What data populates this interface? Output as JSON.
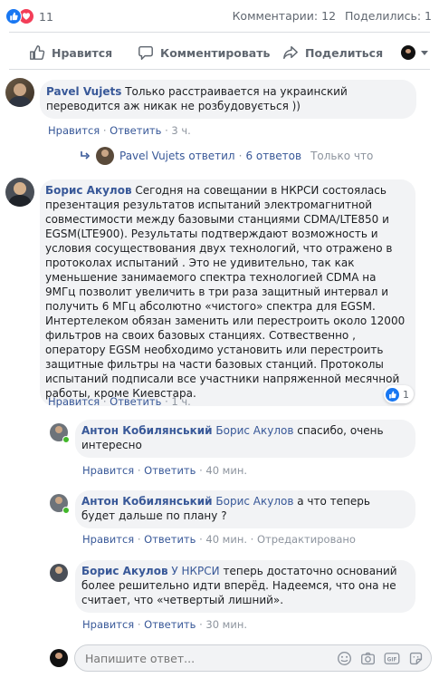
{
  "stats": {
    "reaction_count": "11",
    "comments": "Комментарии: 12",
    "shares": "Поделились: 1"
  },
  "actions": {
    "like": "Нравится",
    "comment": "Комментировать",
    "share": "Поделиться"
  },
  "meta": {
    "like": "Нравится",
    "reply": "Ответить",
    "sep": "·",
    "edited": "Отредактировано"
  },
  "c1": {
    "author": "Pavel Vujets",
    "text": "Только расстраивается на украинский переводится аж никак не розбудовується ))",
    "time": "3 ч."
  },
  "replies_summary": {
    "author": "Pavel Vujets",
    "verb": "ответил",
    "count": "6 ответов",
    "time": "Только что"
  },
  "c2": {
    "author": "Борис Акулов",
    "text": "Сегодня на совещании в НКРСИ состоялась презентация результатов испытаний электромагнитной совместимости между базовыми станциями CDMA/LTE850 и EGSM(LTE900). Результаты подтверждают возможность и условия сосуществования двух технологий, что отражено в протоколах испытаний . Это не удивительно, так как уменьшение занимаемого спектра технологией CDMA на 9МГц позволит увеличить в три раза защитный интервал и получить 6 МГц абсолютно «чистого» спектра для EGSM. Интертелеком обязан заменить или перестроить около 12000 фильтров на своих базовых станциях. Сотвественно , оператору EGSM необходимо установить или перестроить защитные фильтры на части базовых станций. Протоколы испытаний подписали все участники напряженной месячной работы, кроме Киевстара.",
    "time": "1 ч.",
    "reaction_count": "1"
  },
  "r1": {
    "author": "Антон Кобилянський",
    "mention": "Борис Акулов",
    "text": "спасибо, очень интересно",
    "time": "40 мин."
  },
  "r2": {
    "author": "Антон Кобилянський",
    "mention": "Борис Акулов",
    "text": "а что теперь будет дальше по плану ?",
    "time": "40 мин."
  },
  "r3": {
    "author": "Борис Акулов",
    "mention": "У НКРСИ",
    "text": "теперь достаточно оснований более решительно идти вперёд. Надеемся, что она не считает, что «четвертый лишний».",
    "time": "30 мин."
  },
  "composer": {
    "placeholder": "Напишите ответ..."
  },
  "colors": {
    "link": "#385898",
    "meta": "#8d949e",
    "bubble": "#f2f3f5",
    "like_blue": "#1877f2",
    "love_red": "#f33e58"
  }
}
